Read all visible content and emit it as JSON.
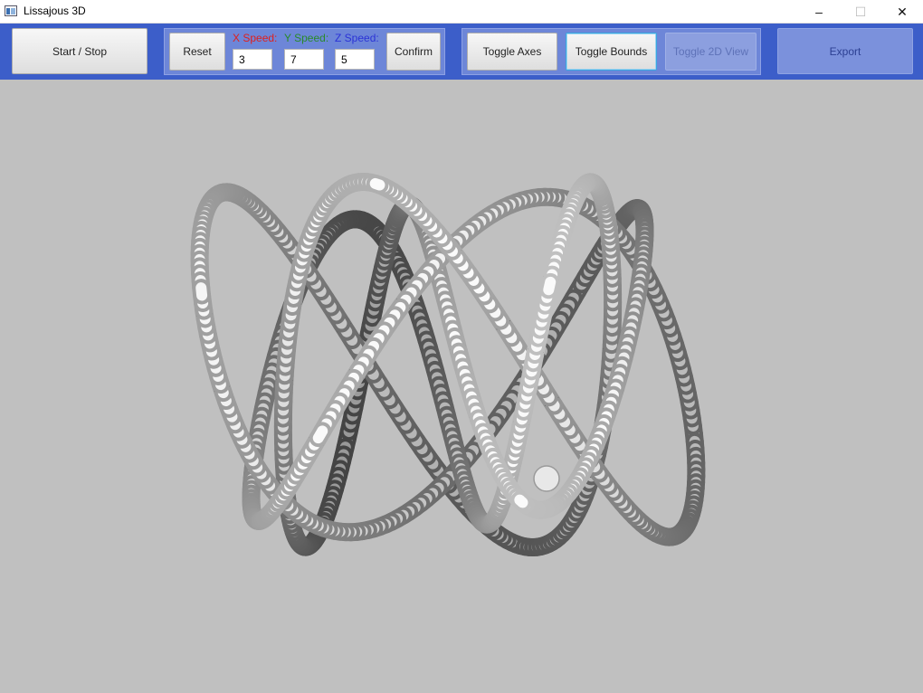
{
  "window": {
    "title": "Lissajous 3D",
    "icon": "app-window-icon",
    "controls": {
      "minimize": "–",
      "maximize": "☐",
      "close": "✕"
    }
  },
  "toolbar": {
    "start_stop": "Start / Stop",
    "reset": "Reset",
    "confirm": "Confirm",
    "toggle_axes": "Toggle Axes",
    "toggle_bounds": "Toggle Bounds",
    "toggle_2d": "Toggle 2D View",
    "export": "Export",
    "speeds": {
      "x": {
        "label": "X Speed:",
        "value": "3",
        "color": "#e0201c"
      },
      "y": {
        "label": "Y Speed:",
        "value": "7",
        "color": "#2a8a2a"
      },
      "z": {
        "label": "Z Speed:",
        "value": "5",
        "color": "#2b33d6"
      }
    }
  },
  "colors": {
    "toolbar": "#3c5ec9",
    "viewport": "#c0c0c0"
  },
  "scene": {
    "curve": "lissajous-3d",
    "frequencies": {
      "x": 3,
      "y": 7,
      "z": 5
    },
    "tube_color": "#f2f2f2",
    "has_marker_sphere": true
  }
}
